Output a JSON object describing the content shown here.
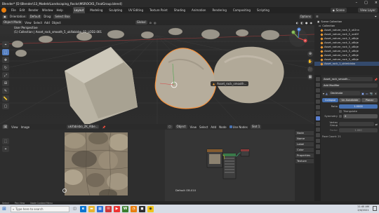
{
  "window": {
    "title": "Blender* [D:\\Blender\\13_Models\\Landscaping_Rocks\\MSROCKS_FinalGroup.blend]"
  },
  "menu": {
    "items": [
      "File",
      "Edit",
      "Render",
      "Window",
      "Help"
    ],
    "workspaces": [
      "Layout",
      "Modeling",
      "Sculpting",
      "UV Editing",
      "Texture Paint",
      "Shading",
      "Animation",
      "Rendering",
      "Compositing",
      "Scripting"
    ],
    "active_workspace": "Layout",
    "scene": "Scene",
    "view_layer": "View Layer"
  },
  "viewport": {
    "header_row1": [
      "Orientation:",
      "Default",
      "Drag:",
      "Select Box"
    ],
    "header_row2": [
      "Object Mode",
      "View",
      "Select",
      "Add",
      "Object"
    ],
    "transform_orientation": "Global",
    "options_label": "Options",
    "view_name": "User Perspective",
    "collection_info": "(1) Collection | Asset_rock_smooth_5_ukifabisbo_02_LOD2.001",
    "object_tooltip": "Asset_rock_smooth...",
    "tool_icons": [
      "cursor-icon",
      "move-icon",
      "rotate-icon",
      "scale-icon",
      "transform-icon",
      "annotate-icon",
      "measure-icon",
      "add-cube-icon"
    ],
    "gizmo_axes": [
      "X",
      "Y",
      "Z"
    ]
  },
  "image_editor": {
    "header": [
      "View",
      "Image"
    ],
    "image_name": "ukifabisbo_2K_Albe..."
  },
  "node_editor": {
    "header": [
      "Object",
      "View",
      "Select",
      "Add",
      "Node",
      "Use Nodes"
    ],
    "slot": "Slot 1",
    "material": "Default OB",
    "sidebar_tabs": [
      "Node",
      "Name",
      "Label",
      "Color",
      "Properties",
      "Texture"
    ],
    "footer_label": "Default OB.010"
  },
  "outliner": {
    "header_label": "Scene Collection",
    "collection": "Collection",
    "items": [
      "Asset_nature_rock_5_uk2nn",
      "Asset_nature_rock_5_ucd0f",
      "Asset_nature_rock_5_u6bje",
      "Asset_nature_rock_5_u6bje",
      "Asset_nature_rock_5_u6bje",
      "Asset_nature_rock_5_u6bje",
      "Asset_nature_rock_5_u6bje",
      "Asset_nature_rock_5_u6bje",
      "Asset_rock_1_uktmbisbo"
    ]
  },
  "properties": {
    "object_name": "Asset_rock_smooth...",
    "modifier_title": "Add Modifier",
    "modifier_name": "Decimate",
    "modes": [
      "Collapse",
      "Un-Subdivide",
      "Planar"
    ],
    "active_mode": "Collapse",
    "ratio_label": "Ratio",
    "ratio_value": "1.0000",
    "triangulate_label": "Triangulate",
    "symmetry_label": "Symmetry",
    "symmetry_axis": "X",
    "vertex_group_label": "Vertex Group",
    "factor_label": "Factor",
    "factor_value": "1.000",
    "face_count": "Face Count: 21"
  },
  "status_bar": [
    "Select",
    "Pan View",
    "Node Context Menu"
  ],
  "taskbar": {
    "search_placeholder": "Type here to search",
    "time": "11:40 AM",
    "date": "2/4/2021"
  },
  "colors": {
    "accent": "#e87d0d",
    "selection": "#f5923e",
    "active_blue": "#4772b3"
  }
}
